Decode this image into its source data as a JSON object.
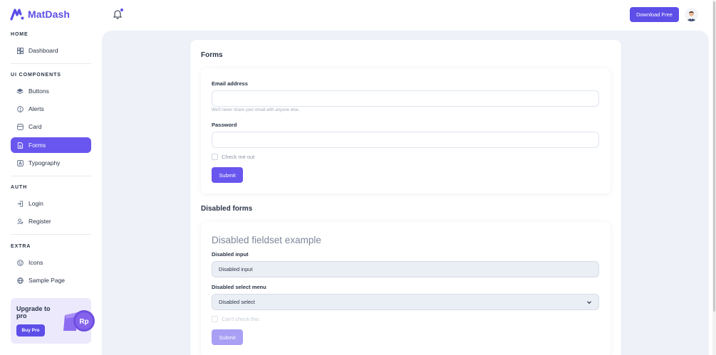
{
  "brand": {
    "name": "MatDash"
  },
  "sidebar": {
    "sections": [
      {
        "caption": "HOME",
        "items": [
          {
            "label": "Dashboard",
            "icon": "dashboard-icon"
          }
        ]
      },
      {
        "caption": "UI COMPONENTS",
        "items": [
          {
            "label": "Buttons",
            "icon": "layers-icon"
          },
          {
            "label": "Alerts",
            "icon": "info-circle-icon"
          },
          {
            "label": "Card",
            "icon": "card-icon"
          },
          {
            "label": "Forms",
            "icon": "file-icon",
            "active": true
          },
          {
            "label": "Typography",
            "icon": "typography-icon"
          }
        ]
      },
      {
        "caption": "AUTH",
        "items": [
          {
            "label": "Login",
            "icon": "login-icon"
          },
          {
            "label": "Register",
            "icon": "user-plus-icon"
          }
        ]
      },
      {
        "caption": "EXTRA",
        "items": [
          {
            "label": "Icons",
            "icon": "mood-icon"
          },
          {
            "label": "Sample Page",
            "icon": "globe-icon"
          }
        ]
      }
    ],
    "upgrade": {
      "title": "Upgrade to pro",
      "button": "Buy Pro",
      "badge": "Rp"
    }
  },
  "topbar": {
    "download_label": "Download Free"
  },
  "forms_card": {
    "title": "Forms",
    "email_label": "Email address",
    "email_help": "We'll never share your email with anyone else.",
    "password_label": "Password",
    "checkbox_label": "Check me out",
    "submit_label": "Submit"
  },
  "disabled_forms": {
    "title": "Disabled forms",
    "fieldset_legend": "Disabled fieldset example",
    "input_label": "Disabled input",
    "input_value": "Disabled input",
    "select_label": "Disabled select menu",
    "select_value": "Disabled select",
    "checkbox_label": "Can't check this",
    "submit_label": "Submit"
  },
  "colors": {
    "accent": "#5d4ee8",
    "active_nav": "#6956ee",
    "main_bg": "#eef2f8",
    "upgrade_bg": "#ece9fd"
  }
}
